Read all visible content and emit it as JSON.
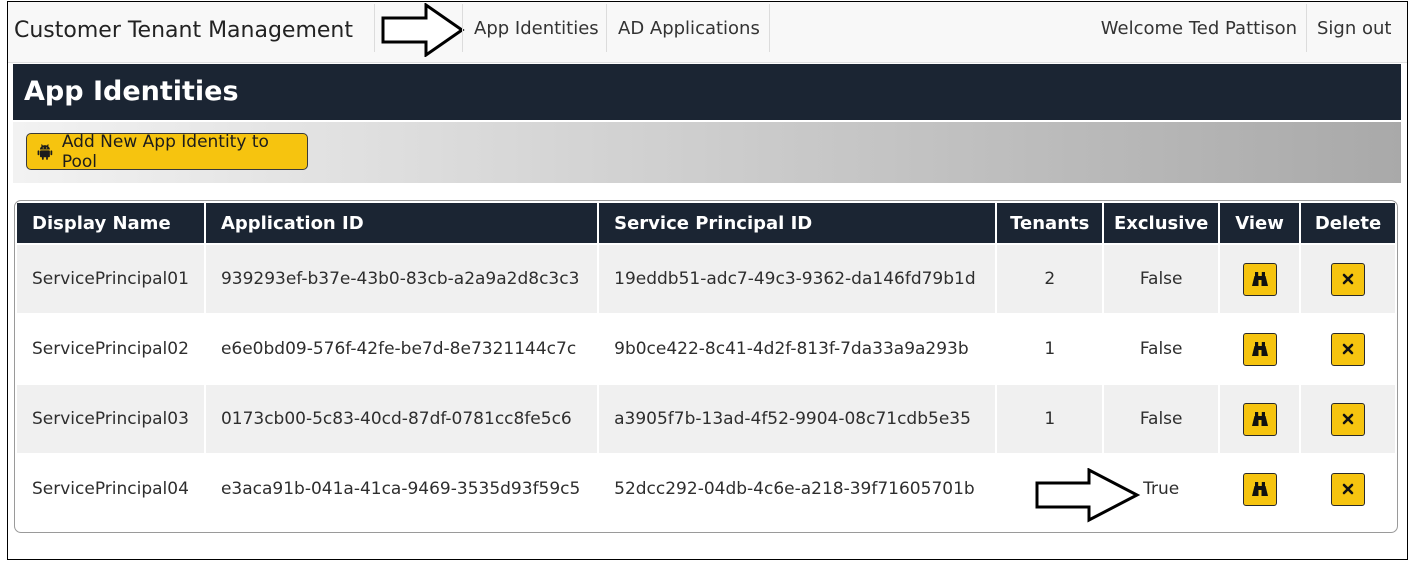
{
  "app": {
    "title": "Customer Tenant Management"
  },
  "nav": {
    "links": [
      {
        "label": "App Identities"
      },
      {
        "label": "AD Applications"
      }
    ],
    "welcome": "Welcome Ted Pattison",
    "sign_out": "Sign out"
  },
  "page": {
    "title": "App Identities"
  },
  "toolbar": {
    "add_label": "Add New App Identity to Pool",
    "add_icon": "android-icon"
  },
  "table": {
    "columns": [
      "Display Name",
      "Application ID",
      "Service Principal ID",
      "Tenants",
      "Exclusive",
      "View",
      "Delete"
    ],
    "rows": [
      {
        "display_name": "ServicePrincipal01",
        "application_id": "939293ef-b37e-43b0-83cb-a2a9a2d8c3c3",
        "service_principal_id": "19eddb51-adc7-49c3-9362-da146fd79b1d",
        "tenants": "2",
        "exclusive": "False"
      },
      {
        "display_name": "ServicePrincipal02",
        "application_id": "e6e0bd09-576f-42fe-be7d-8e7321144c7c",
        "service_principal_id": "9b0ce422-8c41-4d2f-813f-7da33a9a293b",
        "tenants": "1",
        "exclusive": "False"
      },
      {
        "display_name": "ServicePrincipal03",
        "application_id": "0173cb00-5c83-40cd-87df-0781cc8fe5c6",
        "service_principal_id": "a3905f7b-13ad-4f52-9904-08c71cdb5e35",
        "tenants": "1",
        "exclusive": "False"
      },
      {
        "display_name": "ServicePrincipal04",
        "application_id": "e3aca91b-041a-41ca-9469-3535d93f59c5",
        "service_principal_id": "52dcc292-04db-4c6e-a218-39f71605701b",
        "tenants": "",
        "exclusive": "True"
      }
    ],
    "view_icon": "binoculars-icon",
    "delete_icon": "close-icon"
  },
  "colors": {
    "navbar_bg": "#f8f8f8",
    "header_bg": "#1b2533",
    "accent_yellow": "#f6c40f",
    "row_alt_bg": "#f0f0f0"
  }
}
